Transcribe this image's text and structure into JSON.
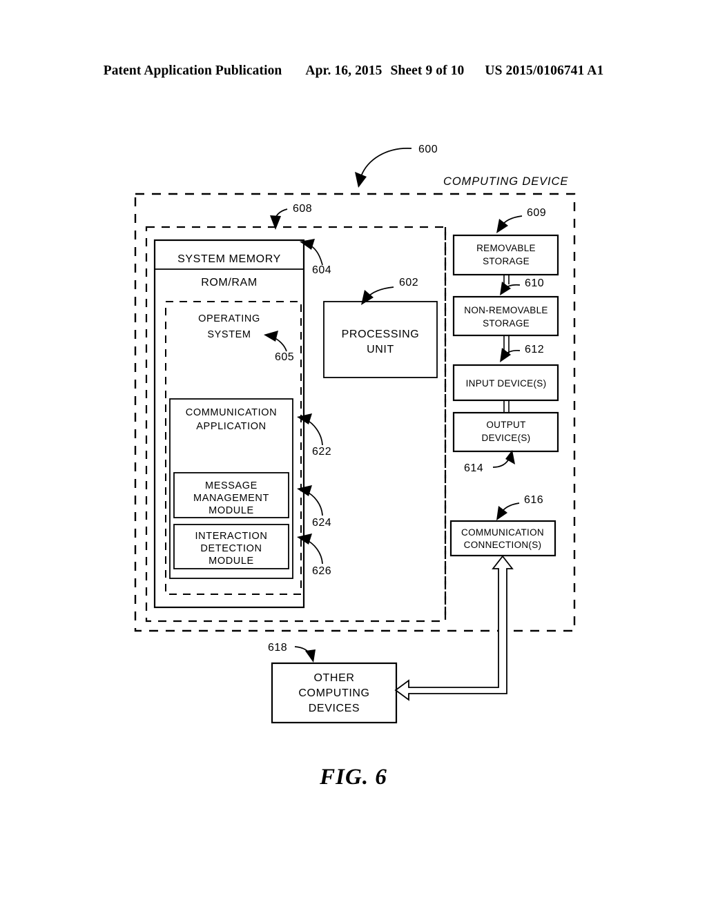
{
  "header": {
    "publication": "Patent Application Publication",
    "date": "Apr. 16, 2015",
    "sheet": "Sheet 9 of 10",
    "patent_number": "US 2015/0106741 A1"
  },
  "figure": {
    "caption": "FIG. 6",
    "overall_ref": "600",
    "device_title": "COMPUTING DEVICE"
  },
  "blocks": {
    "system_memory": {
      "label": "SYSTEM MEMORY",
      "sublabel": "ROM/RAM",
      "ref": "604",
      "container_ref": "608"
    },
    "operating_system": {
      "line1": "OPERATING",
      "line2": "SYSTEM",
      "ref": "605"
    },
    "communication_application": {
      "line1": "COMMUNICATION",
      "line2": "APPLICATION",
      "ref": "622"
    },
    "message_management": {
      "line1": "MESSAGE",
      "line2": "MANAGEMENT",
      "line3": "MODULE",
      "ref": "624"
    },
    "interaction_detection": {
      "line1": "INTERACTION",
      "line2": "DETECTION",
      "line3": "MODULE",
      "ref": "626"
    },
    "processing_unit": {
      "line1": "PROCESSING",
      "line2": "UNIT",
      "ref": "602"
    },
    "removable_storage": {
      "line1": "REMOVABLE",
      "line2": "STORAGE",
      "ref": "609"
    },
    "non_removable_storage": {
      "line1": "NON-REMOVABLE",
      "line2": "STORAGE",
      "ref": "610"
    },
    "input_devices": {
      "line1": "INPUT DEVICE(S)",
      "ref": "612"
    },
    "output_devices": {
      "line1": "OUTPUT",
      "line2": "DEVICE(S)",
      "ref": "614"
    },
    "communication_connections": {
      "line1": "COMMUNICATION",
      "line2": "CONNECTION(S)",
      "ref": "616"
    },
    "other_computing_devices": {
      "line1": "OTHER",
      "line2": "COMPUTING",
      "line3": "DEVICES",
      "ref": "618"
    }
  }
}
